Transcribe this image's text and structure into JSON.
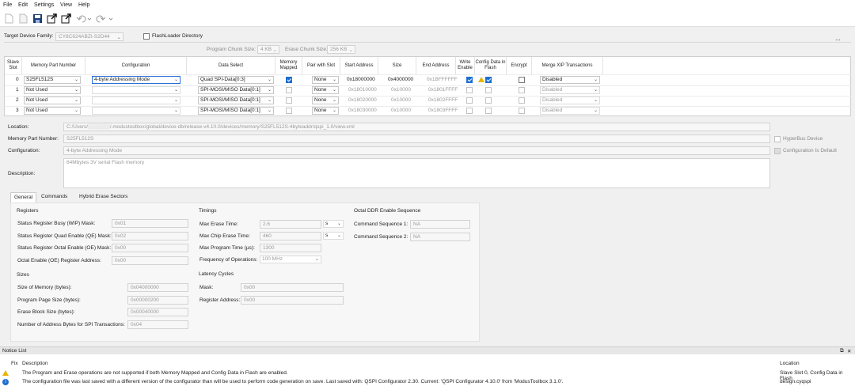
{
  "menu": [
    "File",
    "Edit",
    "Settings",
    "View",
    "Help"
  ],
  "toolbar": {
    "icons": [
      "new-icon",
      "open-icon",
      "save-icon",
      "export-icon",
      "export-alt-icon",
      "undo-icon",
      "redo-icon"
    ]
  },
  "device": {
    "family_label": "Target Device Family:",
    "family_value": "CY8C624ABZI-S2D44",
    "flashloader_label": "FlashLoader Directory",
    "program_chunk_label": "Program Chunk Size:",
    "program_chunk_value": "4 KB",
    "erase_chunk_label": "Erase Chunk Size:",
    "erase_chunk_value": "256 KB",
    "more": "..."
  },
  "grid": {
    "headers": [
      "Slave Slot",
      "Memory Part Number",
      "Configuration",
      "Data Select",
      "Memory Mapped",
      "Pair with Slot",
      "Start Address",
      "Size",
      "End Address",
      "Write Enable",
      "Config Data in Flash",
      "Encrypt",
      "Merge XIP Transactions"
    ],
    "rows": [
      {
        "slot": "0",
        "part": "S25FL512S",
        "config": "4-byte Addressing Mode",
        "data": "Quad SPI-Data[0:3]",
        "mapped": true,
        "pair": "None",
        "start": "0x18000000",
        "size": "0x4000000",
        "end": "0x1BFFFFFF",
        "write": true,
        "cfgflash": true,
        "encrypt": false,
        "merge": "Disabled"
      },
      {
        "slot": "1",
        "part": "Not Used",
        "config": "",
        "data": "SPI-MOSI/MISO Data[0:1]",
        "mapped": false,
        "pair": "None",
        "start": "0x18010000",
        "size": "0x10000",
        "end": "0x1801FFFF",
        "write": false,
        "cfgflash": false,
        "encrypt": false,
        "merge": "Disabled"
      },
      {
        "slot": "2",
        "part": "Not Used",
        "config": "",
        "data": "SPI-MOSI/MISO Data[0:1]",
        "mapped": false,
        "pair": "None",
        "start": "0x18020000",
        "size": "0x10000",
        "end": "0x1802FFFF",
        "write": false,
        "cfgflash": false,
        "encrypt": false,
        "merge": "Disabled"
      },
      {
        "slot": "3",
        "part": "Not Used",
        "config": "",
        "data": "SPI-MOSI/MISO Data[0:1]",
        "mapped": false,
        "pair": "None",
        "start": "0x18030000",
        "size": "0x10000",
        "end": "0x1803FFFF",
        "write": false,
        "cfgflash": false,
        "encrypt": false,
        "merge": "Disabled"
      }
    ]
  },
  "details": {
    "location_label": "Location:",
    "location_value": "C:/Users/░░░░░░/.modustoolbox/global/device-db/release-v4.10.0/devices/memory/S25FL512S-4byteaddr/qspi_1.0/view.xml",
    "part_label": "Memory Part Number:",
    "part_value": "S25FL512S",
    "hyperbus_label": "HyperBus Device",
    "config_label": "Configuration:",
    "config_value": "4-byte Addressing Mode",
    "config_default_label": "Configuration Is Default",
    "desc_label": "Description:",
    "desc_value": "64Mbytes 3V serial Flash memory"
  },
  "tabs": [
    "General",
    "Commands",
    "Hybrid Erase Sectors"
  ],
  "general": {
    "registers_title": "Registers",
    "registers": [
      {
        "label": "Status Register Busy (WIP) Mask:",
        "value": "0x01"
      },
      {
        "label": "Status Register Quad Enable (QE) Mask:",
        "value": "0x02"
      },
      {
        "label": "Status Register Octal Enable (OE) Mask:",
        "value": "0x00"
      },
      {
        "label": "Octal Enable (OE) Register Address:",
        "value": "0x00"
      }
    ],
    "sizes_title": "Sizes",
    "sizes": [
      {
        "label": "Size of Memory (bytes):",
        "value": "0x04000000"
      },
      {
        "label": "Program Page Size (bytes):",
        "value": "0x00000200"
      },
      {
        "label": "Erase Block Size (bytes):",
        "value": "0x00040000"
      },
      {
        "label": "Number of Address Bytes for SPI Transactions:",
        "value": "0x04"
      }
    ],
    "timings_title": "Timings",
    "timings": [
      {
        "label": "Max Erase Time:",
        "value": "2.6",
        "unit": "s"
      },
      {
        "label": "Max Chip Erase Time:",
        "value": "460",
        "unit": "s"
      },
      {
        "label": "Max Program Time (µs):",
        "value": "1300",
        "unit": ""
      },
      {
        "label": "Frequency of Operations:",
        "value": "100 MHz",
        "unit": ""
      }
    ],
    "latency_title": "Latency Cycles",
    "latency": [
      {
        "label": "Mask:",
        "value": "0x00"
      },
      {
        "label": "Register Address:",
        "value": "0x00"
      }
    ],
    "octal_title": "Octal DDR Enable Sequence",
    "octal": [
      {
        "label": "Command Sequence 1:",
        "value": "NA"
      },
      {
        "label": "Command Sequence 2:",
        "value": "NA"
      }
    ]
  },
  "notices": {
    "title": "Notice List",
    "col_fix": "Fix",
    "col_desc": "Description",
    "col_loc": "Location",
    "rows": [
      {
        "type": "warning",
        "desc": "The Program and Erase operations are not supported if both Memory Mapped and Config Data in Flash are enabled.",
        "loc": "Slave Slot 0, Config Data in Flash"
      },
      {
        "type": "info",
        "desc": "The configuration file was last saved with a different version of the configurator than will be used to perform code generation on save. Last saved with: QSPI Configurator 2.30. Current: 'QSPI Configurator 4.10.0' from 'ModusToolbox 3.1.0'.",
        "loc": "design.cyqspi"
      }
    ]
  }
}
